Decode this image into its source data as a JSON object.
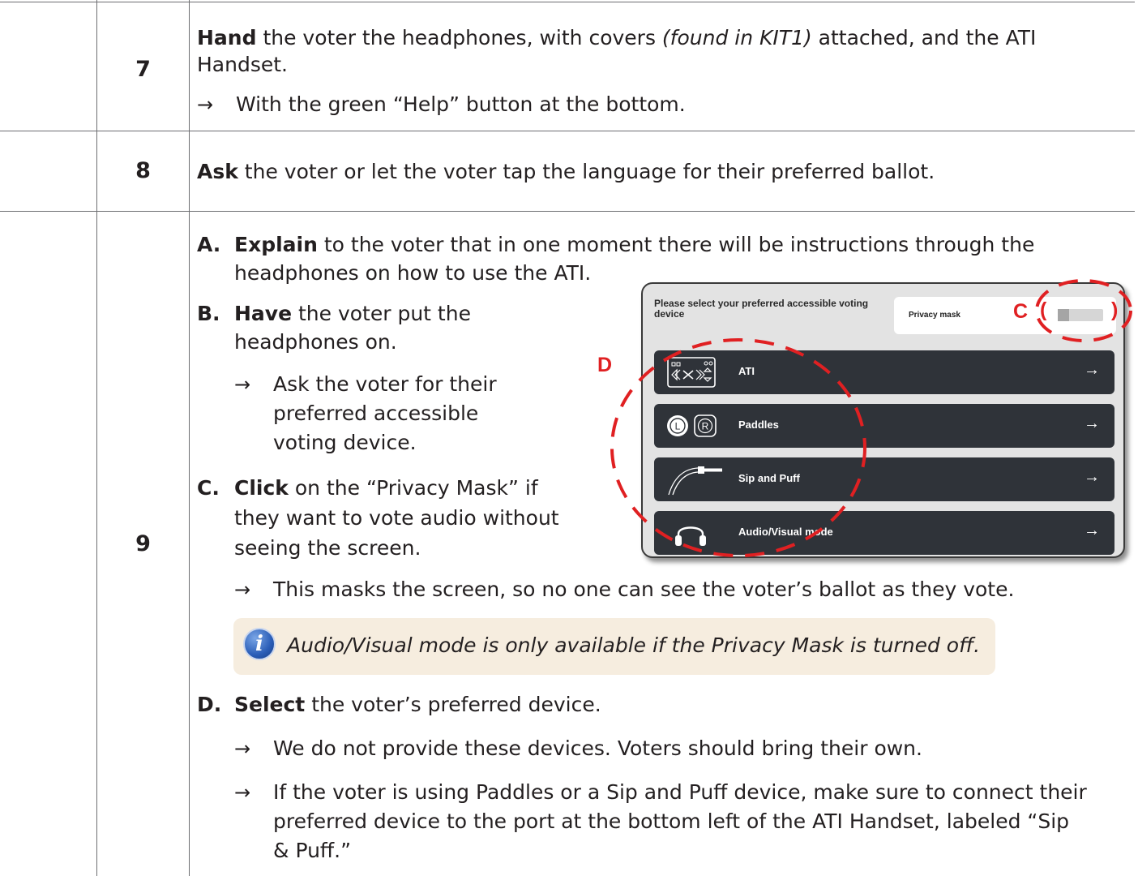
{
  "steps": [
    {
      "number": "7",
      "intro_bold": "Hand",
      "intro_text_1": " the voter the headphones, with covers ",
      "intro_italic": "(found in KIT1)",
      "intro_text_2": " attached, and the ATI",
      "intro_line2": "Handset.",
      "arrow_text": "With the green “Help” button at the bottom."
    },
    {
      "number": "8",
      "bold": "Ask",
      "text": " the voter or let the voter tap the language for their preferred ballot."
    },
    {
      "number": "9",
      "a_letter": "A.",
      "a_bold": "Explain",
      "a_line1": " to the voter that in one moment there will be instructions through the",
      "a_line2": "headphones on how to use the ATI.",
      "b_letter": "B.",
      "b_bold": "Have",
      "b_line1": " the voter put the",
      "b_line2": "headphones on.",
      "b_sub1": "Ask the voter for their",
      "b_sub2": "preferred accessible",
      "b_sub3": "voting device.",
      "c_letter": "C.",
      "c_bold": "Click",
      "c_line1": " on the “Privacy Mask” if",
      "c_line2": "they want to vote audio without",
      "c_line3": "seeing the screen.",
      "c_arrow": "This masks the screen, so no one can see the voter’s ballot as they vote.",
      "note": "Audio/Visual mode is only available if the Privacy Mask is turned off.",
      "d_letter": "D.",
      "d_bold": "Select",
      "d_line1": " the voter’s preferred device.",
      "d_arrow1": "We do not provide these devices.  Voters should bring their own.",
      "d_arrow2_l1": "If the voter is using Paddles or a Sip and Puff device, make sure to connect their",
      "d_arrow2_l2": "preferred device to the port at the bottom left of the ATI Handset, labeled “Sip",
      "d_arrow2_l3": "& Puff.”"
    }
  ],
  "arrow_glyph": "→",
  "screen": {
    "title": "Please select your preferred accessible voting device",
    "privacy_label": "Privacy mask",
    "devices": [
      {
        "label": "ATI",
        "icon": "ati-handset-icon",
        "arrow": "→"
      },
      {
        "label": "Paddles",
        "icon": "paddles-icon",
        "arrow": "→"
      },
      {
        "label": "Sip and Puff",
        "icon": "sip-puff-icon",
        "arrow": "→"
      },
      {
        "label": "Audio/Visual mode",
        "icon": "headphones-icon",
        "arrow": "→"
      }
    ],
    "paddle_left": "L",
    "paddle_right": "R"
  },
  "callouts": {
    "c": "C",
    "c_paren_open": "(",
    "c_paren_close": ")",
    "d": "D"
  },
  "colors": {
    "callout_red": "#e02022",
    "button_dark": "#2f3339",
    "note_bg": "#f6eddf",
    "screen_bg": "#e3e3e3"
  }
}
